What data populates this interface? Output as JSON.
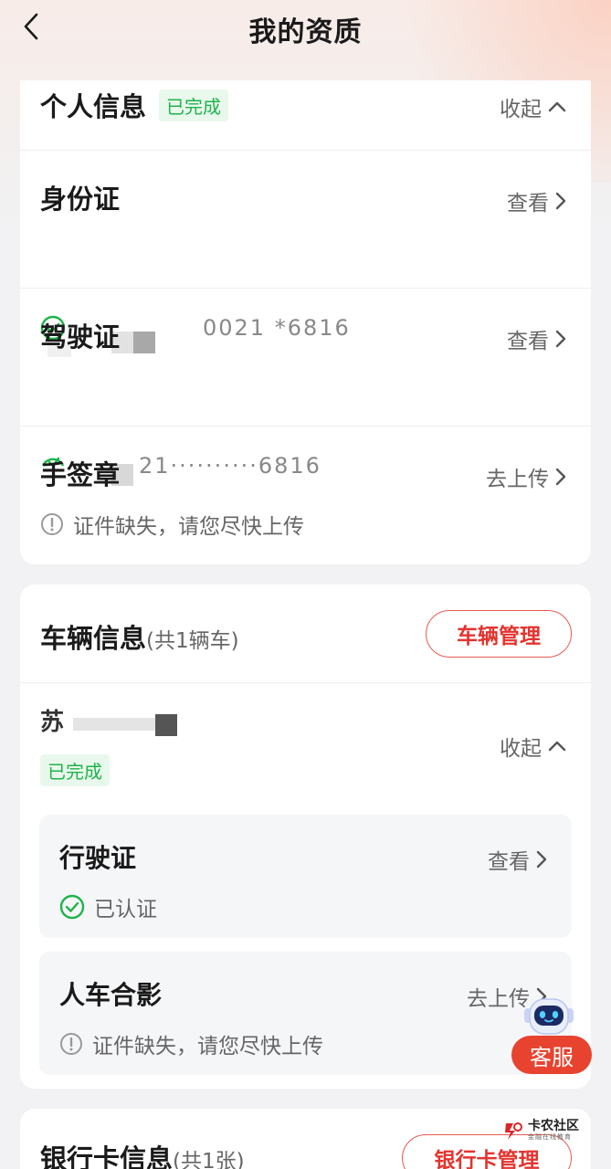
{
  "header": {
    "title": "我的资质"
  },
  "personal": {
    "title": "个人信息",
    "status": "已完成",
    "collapse_label": "收起",
    "id_card": {
      "title": "身份证",
      "action": "查看",
      "masked_number": "0021         *6816"
    },
    "license": {
      "title": "驾驶证",
      "action": "查看",
      "masked_number": "21··········6816"
    },
    "signature": {
      "title": "手签章",
      "action": "去上传",
      "hint": "证件缺失，请您尽快上传"
    }
  },
  "vehicle": {
    "title": "车辆信息",
    "count_note": "(共1辆车)",
    "manage_button": "车辆管理",
    "plate": "苏",
    "status": "已完成",
    "collapse_label": "收起",
    "driving_license": {
      "title": "行驶证",
      "action": "查看",
      "status": "已认证"
    },
    "photo": {
      "title": "人车合影",
      "action": "去上传",
      "hint": "证件缺失，请您尽快上传"
    }
  },
  "bank": {
    "title": "银行卡信息",
    "count_note": "(共1张)",
    "manage_button": "银行卡管理"
  },
  "service": {
    "label": "客服"
  },
  "watermark": {
    "name": "卡农社区",
    "sub": "金融在线教育"
  },
  "colors": {
    "accent": "#e3342f",
    "success": "#1fb34a",
    "service_bg": "#e8432f"
  }
}
